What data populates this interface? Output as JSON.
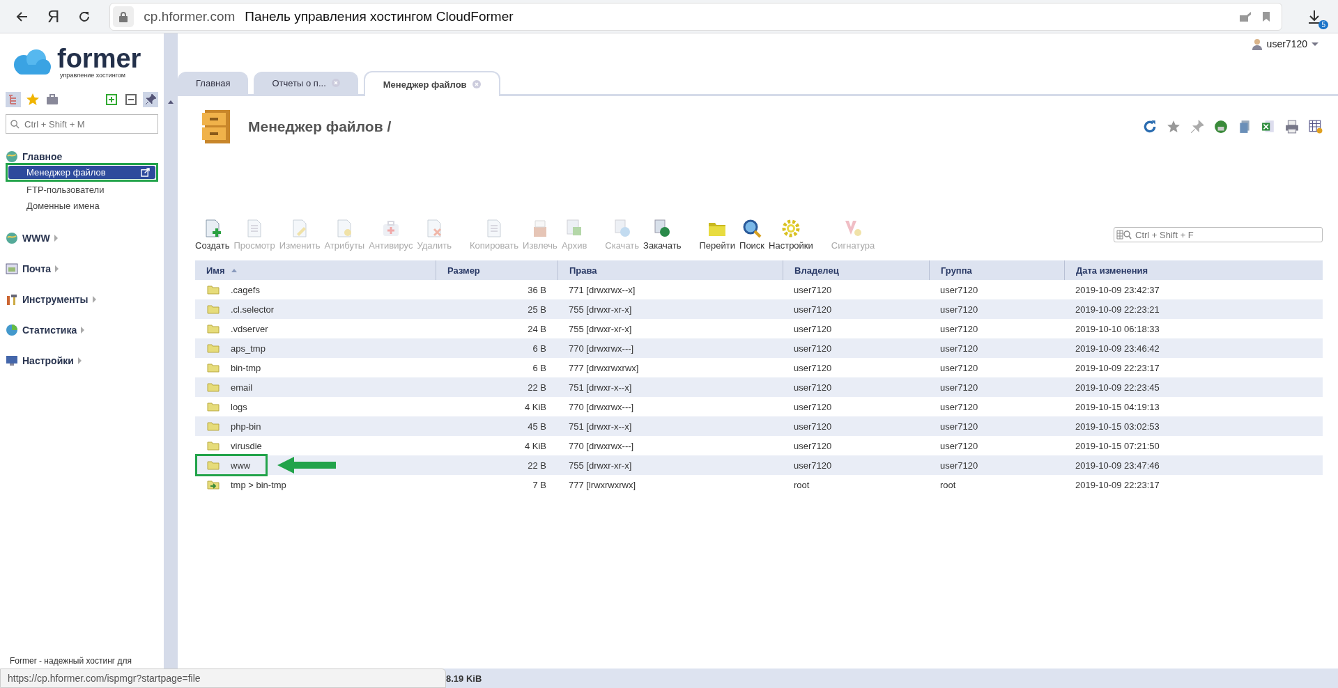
{
  "browser": {
    "logo": "Я",
    "domain": "cp.hformer.com",
    "title": "Панель управления хостингом CloudFormer",
    "downloads_badge": "5",
    "hover_url": "https://cp.hformer.com/ispmgr?startpage=file"
  },
  "brand": {
    "name": "former",
    "tagline": "управление хостингом"
  },
  "user": {
    "name": "user7120"
  },
  "sidebar": {
    "search": {
      "placeholder": "Ctrl + Shift + M"
    },
    "sections": [
      {
        "label": "Главное",
        "expanded": true,
        "children": [
          {
            "label": "Менеджер файлов",
            "selected": true,
            "highlighted": true
          },
          {
            "label": "FTP-пользователи",
            "selected": false,
            "highlighted": false
          },
          {
            "label": "Доменные имена",
            "selected": false,
            "highlighted": false
          }
        ]
      },
      {
        "label": "WWW",
        "expanded": false
      },
      {
        "label": "Почта",
        "expanded": false
      },
      {
        "label": "Инструменты",
        "expanded": false
      },
      {
        "label": "Статистика",
        "expanded": false
      },
      {
        "label": "Настройки",
        "expanded": false
      }
    ],
    "footer": "Former - надежный хостинг для"
  },
  "tabs": [
    {
      "label": "Главная",
      "selected": false,
      "closable": false
    },
    {
      "label": "Отчеты о п...",
      "selected": false,
      "closable": true
    },
    {
      "label": "Менеджер файлов",
      "selected": true,
      "closable": true
    }
  ],
  "page": {
    "title": "Менеджер файлов /"
  },
  "toolbar": {
    "groups": [
      [
        {
          "label": "Создать",
          "disabled": false
        },
        {
          "label": "Просмотр",
          "disabled": true
        },
        {
          "label": "Изменить",
          "disabled": true
        },
        {
          "label": "Атрибуты",
          "disabled": true
        },
        {
          "label": "Антивирус",
          "disabled": true
        },
        {
          "label": "Удалить",
          "disabled": true
        }
      ],
      [
        {
          "label": "Копировать",
          "disabled": true
        },
        {
          "label": "Извлечь",
          "disabled": true
        },
        {
          "label": "Архив",
          "disabled": true
        }
      ],
      [
        {
          "label": "Скачать",
          "disabled": true
        },
        {
          "label": "Закачать",
          "disabled": false
        }
      ],
      [
        {
          "label": "Перейти",
          "disabled": false
        },
        {
          "label": "Поиск",
          "disabled": false
        },
        {
          "label": "Настройки",
          "disabled": false
        }
      ],
      [
        {
          "label": "Сигнатура",
          "disabled": true
        }
      ]
    ],
    "search": {
      "placeholder": "Ctrl + Shift + F"
    }
  },
  "table": {
    "columns": [
      {
        "label": "Имя",
        "sorted": true
      },
      {
        "label": "Размер",
        "sorted": false
      },
      {
        "label": "Права",
        "sorted": false
      },
      {
        "label": "Владелец",
        "sorted": false
      },
      {
        "label": "Группа",
        "sorted": false
      },
      {
        "label": "Дата изменения",
        "sorted": false
      }
    ],
    "rows": [
      {
        "kind": "folder",
        "name": ".cagefs",
        "size": "36 B",
        "rights": "771 [drwxrwx--x]",
        "owner": "user7120",
        "group": "user7120",
        "modified": "2019-10-09 23:42:37",
        "highlighted": false
      },
      {
        "kind": "folder",
        "name": ".cl.selector",
        "size": "25 B",
        "rights": "755 [drwxr-xr-x]",
        "owner": "user7120",
        "group": "user7120",
        "modified": "2019-10-09 22:23:21",
        "highlighted": false
      },
      {
        "kind": "folder",
        "name": ".vdserver",
        "size": "24 B",
        "rights": "755 [drwxr-xr-x]",
        "owner": "user7120",
        "group": "user7120",
        "modified": "2019-10-10 06:18:33",
        "highlighted": false
      },
      {
        "kind": "folder",
        "name": "aps_tmp",
        "size": "6 B",
        "rights": "770 [drwxrwx---]",
        "owner": "user7120",
        "group": "user7120",
        "modified": "2019-10-09 23:46:42",
        "highlighted": false
      },
      {
        "kind": "folder",
        "name": "bin-tmp",
        "size": "6 B",
        "rights": "777 [drwxrwxrwx]",
        "owner": "user7120",
        "group": "user7120",
        "modified": "2019-10-09 22:23:17",
        "highlighted": false
      },
      {
        "kind": "folder",
        "name": "email",
        "size": "22 B",
        "rights": "751 [drwxr-x--x]",
        "owner": "user7120",
        "group": "user7120",
        "modified": "2019-10-09 22:23:45",
        "highlighted": false
      },
      {
        "kind": "folder",
        "name": "logs",
        "size": "4 KiB",
        "rights": "770 [drwxrwx---]",
        "owner": "user7120",
        "group": "user7120",
        "modified": "2019-10-15 04:19:13",
        "highlighted": false
      },
      {
        "kind": "folder",
        "name": "php-bin",
        "size": "45 B",
        "rights": "751 [drwxr-x--x]",
        "owner": "user7120",
        "group": "user7120",
        "modified": "2019-10-15 03:02:53",
        "highlighted": false
      },
      {
        "kind": "folder",
        "name": "virusdie",
        "size": "4 KiB",
        "rights": "770 [drwxrwx---]",
        "owner": "user7120",
        "group": "user7120",
        "modified": "2019-10-15 07:21:50",
        "highlighted": false
      },
      {
        "kind": "folder",
        "name": "www",
        "size": "22 B",
        "rights": "755 [drwxr-xr-x]",
        "owner": "user7120",
        "group": "user7120",
        "modified": "2019-10-09 23:47:46",
        "highlighted": true
      },
      {
        "kind": "link",
        "name": "tmp > bin-tmp",
        "size": "7 B",
        "rights": "777 [lrwxrwxrwx]",
        "owner": "root",
        "group": "root",
        "modified": "2019-10-09 22:23:17",
        "highlighted": false
      }
    ]
  },
  "status_bar": {
    "text": "8.19 KiB"
  }
}
